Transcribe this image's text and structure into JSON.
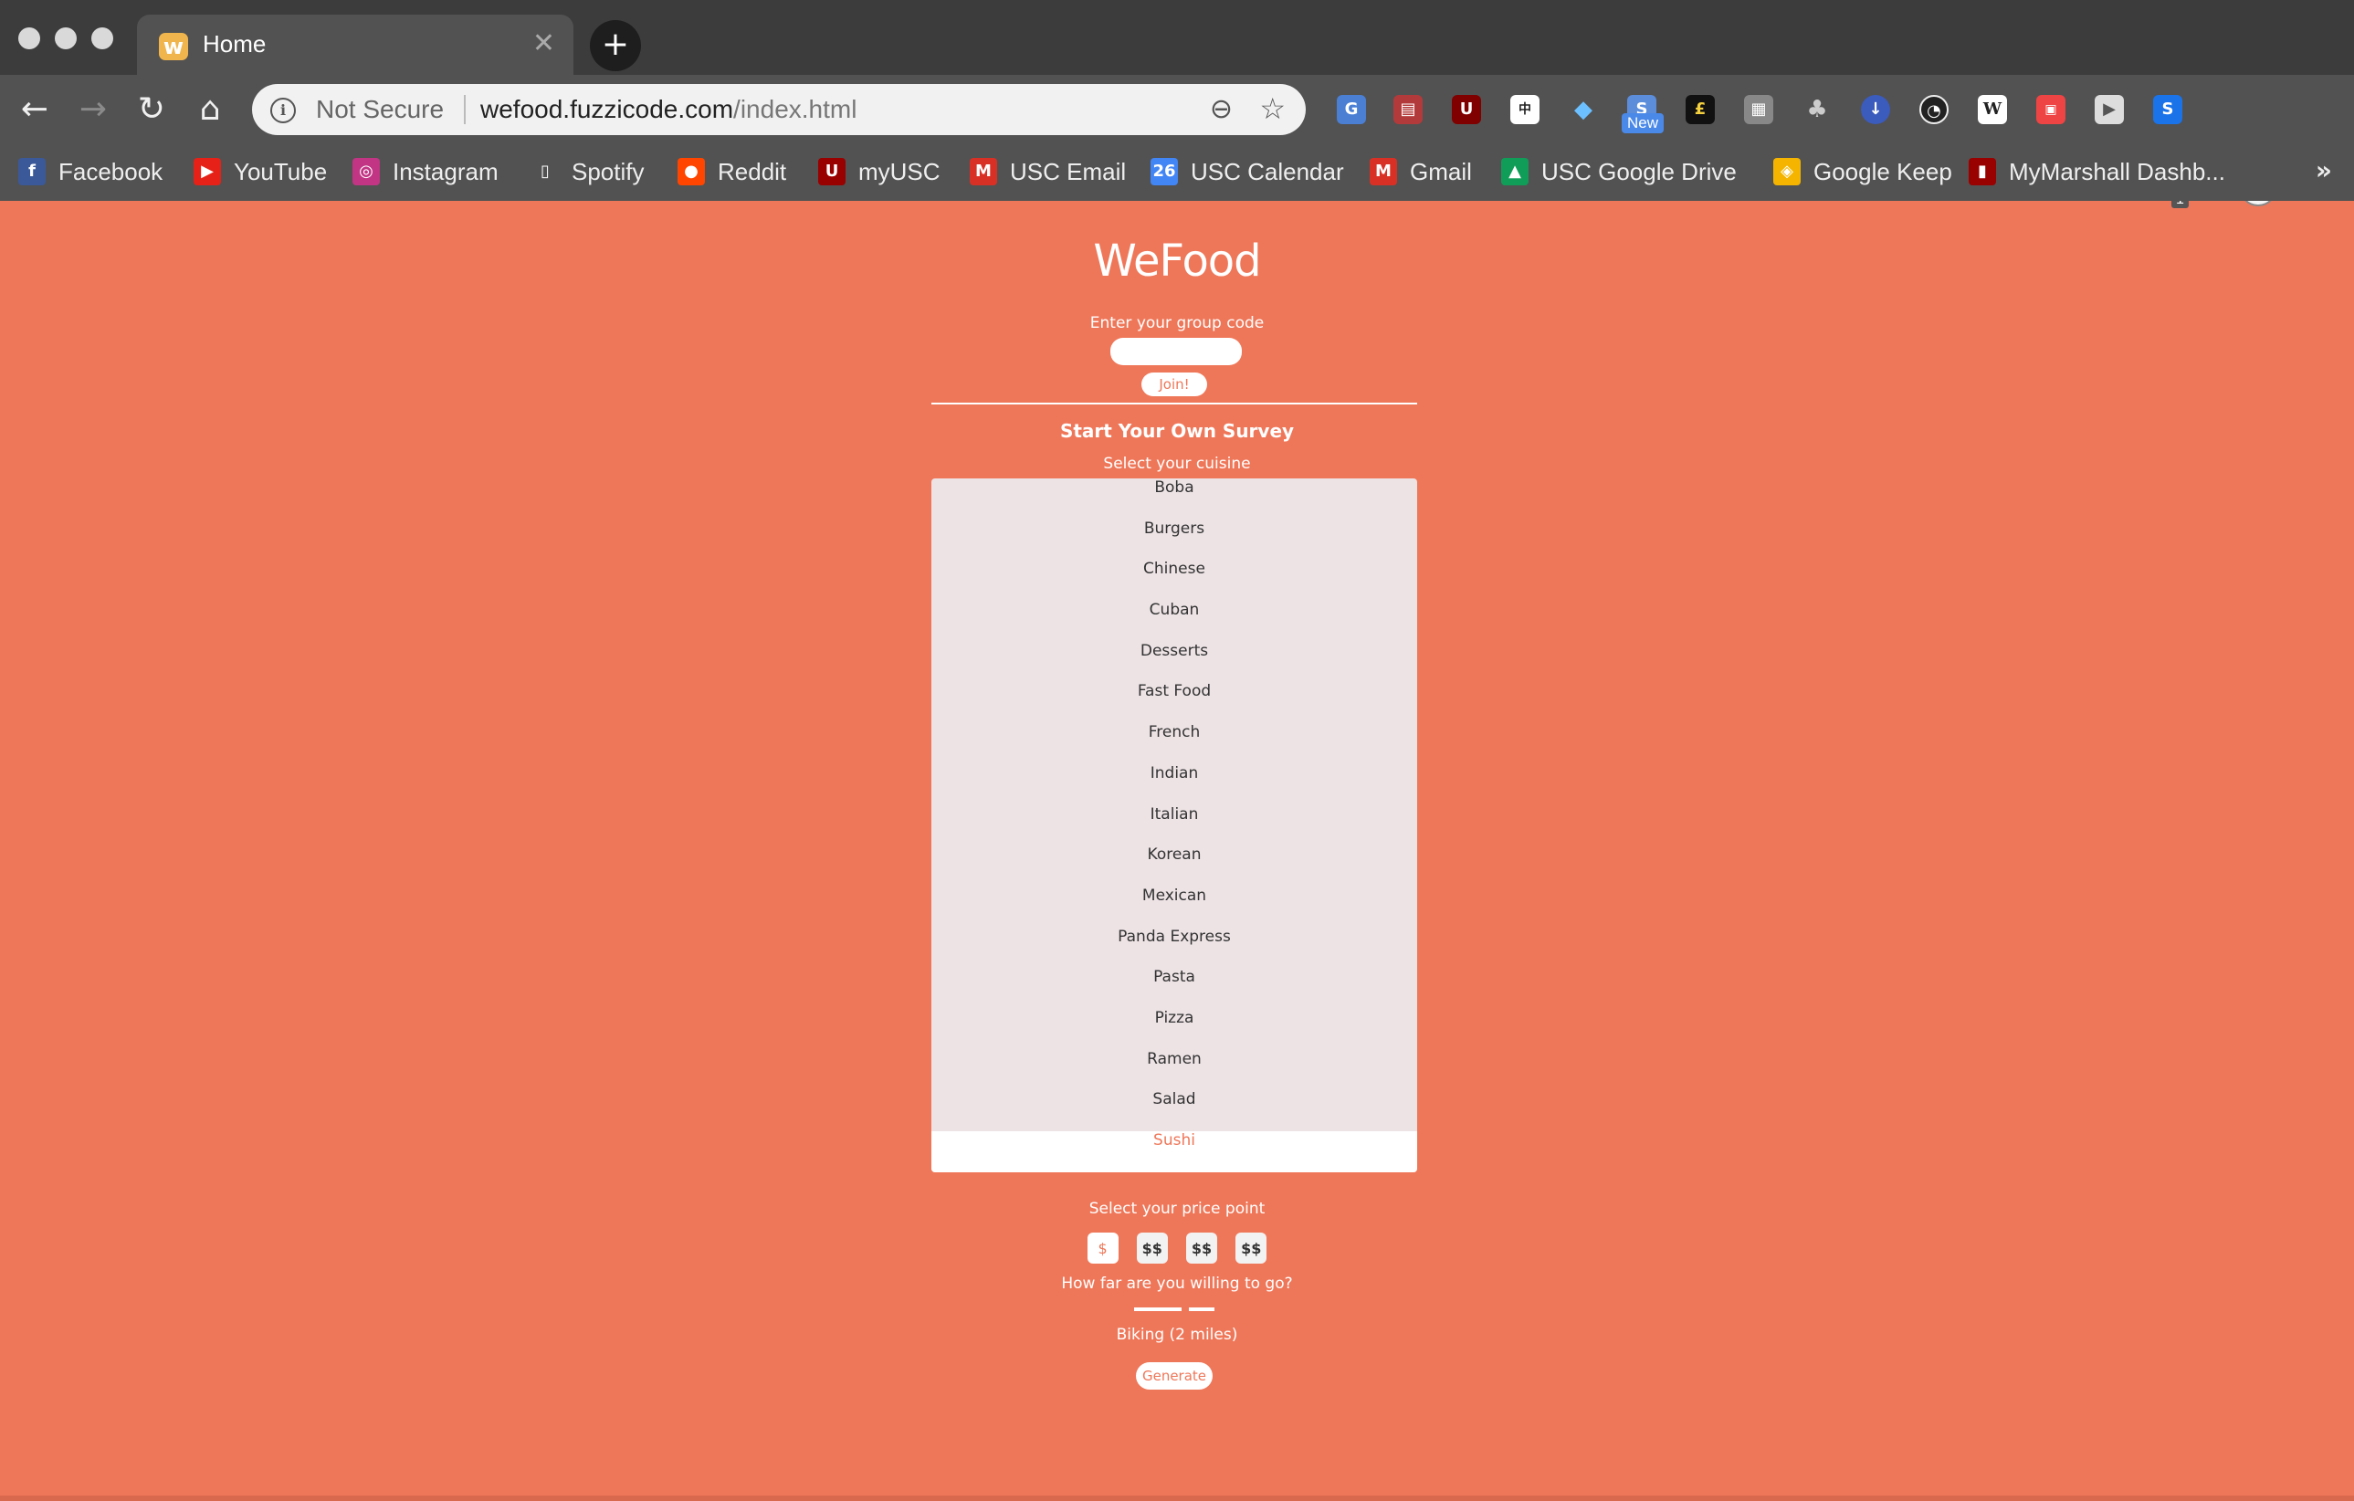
{
  "browser": {
    "tab": {
      "title": "Home",
      "favicon": "w-icon"
    },
    "omnibox": {
      "security": "Not Secure",
      "domain": "wefood.fuzzicode.com",
      "path": "/index.html"
    },
    "extension_badge": "New",
    "extension_count": "1",
    "bookmarks": [
      {
        "label": "Facebook",
        "icon": "facebook-icon",
        "color": "#3b5998",
        "glyph": "f"
      },
      {
        "label": "YouTube",
        "icon": "youtube-icon",
        "color": "#e62117",
        "glyph": "▶"
      },
      {
        "label": "Instagram",
        "icon": "instagram-icon",
        "color": "#c13584",
        "glyph": "◎"
      },
      {
        "label": "Spotify",
        "icon": "document-icon",
        "color": "#525252",
        "glyph": "▯"
      },
      {
        "label": "Reddit",
        "icon": "reddit-icon",
        "color": "#ff4500",
        "glyph": "●"
      },
      {
        "label": "myUSC",
        "icon": "usc-icon",
        "color": "#990000",
        "glyph": "U"
      },
      {
        "label": "USC Email",
        "icon": "gmail-icon",
        "color": "#d93025",
        "glyph": "M"
      },
      {
        "label": "USC Calendar",
        "icon": "calendar-icon",
        "color": "#4285f4",
        "glyph": "26"
      },
      {
        "label": "Gmail",
        "icon": "gmail-icon",
        "color": "#d93025",
        "glyph": "M"
      },
      {
        "label": "USC Google Drive",
        "icon": "drive-icon",
        "color": "#0f9d58",
        "glyph": "▲"
      },
      {
        "label": "Google Keep",
        "icon": "keep-icon",
        "color": "#f4b400",
        "glyph": "◈"
      },
      {
        "label": "MyMarshall Dashb...",
        "icon": "marshall-icon",
        "color": "#990000",
        "glyph": "▮"
      }
    ],
    "bookmarks_overflow": "»"
  },
  "page": {
    "logo": "WeFood",
    "group_code_label": "Enter your group code",
    "group_code_value": "",
    "join_label": "Join!",
    "survey_title": "Start Your Own Survey",
    "cuisine_label": "Select your cuisine",
    "cuisines": [
      "Boba",
      "Burgers",
      "Chinese",
      "Cuban",
      "Desserts",
      "Fast Food",
      "French",
      "Indian",
      "Italian",
      "Korean",
      "Mexican",
      "Panda Express",
      "Pasta",
      "Pizza",
      "Ramen",
      "Salad",
      "Sushi"
    ],
    "selected_cuisine": "Sushi",
    "price_label": "Select your price point",
    "price_options": [
      "$",
      "$$",
      "$$",
      "$$"
    ],
    "selected_price": "$",
    "distance_label": "How far are you willing to go?",
    "distance_value": "Biking (2 miles)",
    "generate_label": "Generate"
  },
  "colors": {
    "background": "#ef7759",
    "list_background": "#ede3e5",
    "accent_text": "#ef7759"
  }
}
